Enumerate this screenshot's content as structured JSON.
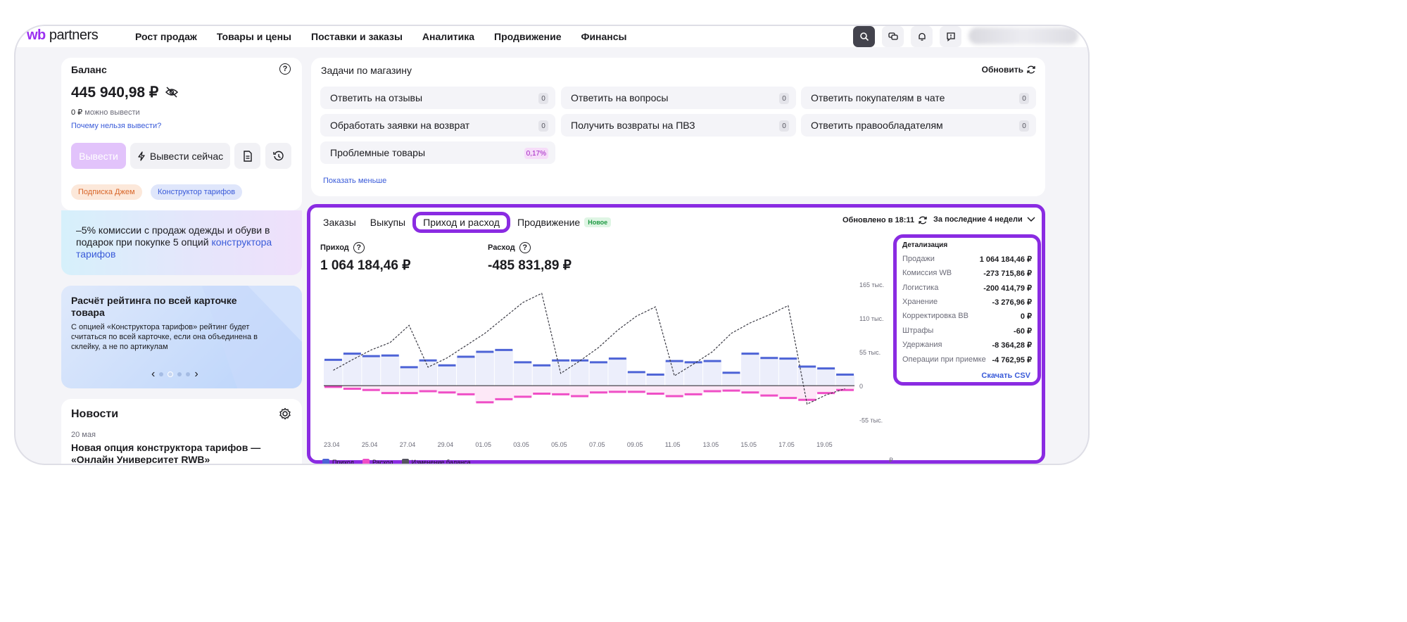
{
  "brand": {
    "wb": "wb",
    "partners": "partners"
  },
  "nav": [
    "Рост продаж",
    "Товары и цены",
    "Поставки и заказы",
    "Аналитика",
    "Продвижение",
    "Финансы"
  ],
  "top_icons": [
    "search-icon",
    "chat-icon",
    "bell-icon",
    "support-icon"
  ],
  "balance": {
    "title": "Баланс",
    "help": "?",
    "amount": "445 940,98 ₽",
    "available_value": "0 ₽",
    "available_label": "можно вывести",
    "why_link": "Почему нельзя вывести?",
    "withdraw_button": "Вывести",
    "withdraw_now_button": "Вывести сейчас",
    "chips": [
      "Подписка Джем",
      "Конструктор тарифов"
    ]
  },
  "promo": {
    "text": "–5% комиссии с продаж одежды и обуви в подарок при покупке 5 опций ",
    "link": "конструктора тарифов"
  },
  "rating": {
    "title": "Расчёт рейтинга по всей карточке товара",
    "body": "С опцией «Конструктора тарифов» рейтинг будет считаться по всей карточке, если она объединена в склейку, а не по артикулам",
    "prev": "‹",
    "next": "›"
  },
  "news": {
    "title": "Новости",
    "date": "20 мая",
    "headline": "Новая опция конструктора тарифов — «Онлайн Университет RWB»"
  },
  "tasks": {
    "title": "Задачи по магазину",
    "refresh": "Обновить",
    "items": [
      {
        "label": "Ответить на отзывы",
        "count": "0"
      },
      {
        "label": "Ответить на вопросы",
        "count": "0"
      },
      {
        "label": "Ответить покупателям в чате",
        "count": "0"
      },
      {
        "label": "Обработать заявки на возврат",
        "count": "0"
      },
      {
        "label": "Получить возвраты на ПВЗ",
        "count": "0"
      },
      {
        "label": "Ответить правообладателям",
        "count": "0"
      },
      {
        "label": "Проблемные товары",
        "count": "0,17%"
      }
    ],
    "show_less": "Показать меньше"
  },
  "finance": {
    "tabs": [
      "Заказы",
      "Выкупы",
      "Приход и расход",
      "Продвижение"
    ],
    "new_badge": "Новое",
    "updated": "Обновлено в 18:11",
    "period": "За последние 4 недели",
    "income_label": "Приход",
    "income_value": "1 064 184,46 ₽",
    "expense_label": "Расход",
    "expense_value": "-485 831,89 ₽",
    "currency_unit": "₽",
    "detail": {
      "title": "Детализация",
      "rows": [
        {
          "label": "Продажи",
          "value": "1 064 184,46 ₽"
        },
        {
          "label": "Комиссия WB",
          "value": "-273 715,86 ₽"
        },
        {
          "label": "Логистика",
          "value": "-200 414,79 ₽"
        },
        {
          "label": "Хранение",
          "value": "-3 276,96 ₽"
        },
        {
          "label": "Корректировка ВВ",
          "value": "0 ₽"
        },
        {
          "label": "Штрафы",
          "value": "-60 ₽"
        },
        {
          "label": "Удержания",
          "value": "-8 364,28 ₽"
        },
        {
          "label": "Операции при приемке",
          "value": "-4 762,95 ₽"
        }
      ],
      "csv": "Скачать CSV"
    },
    "legend": [
      "Приход",
      "Расход",
      "Изменение баланса"
    ]
  },
  "colors": {
    "accent": "#8a2be2",
    "income": "#4d63d6",
    "expense": "#ef4fc6",
    "link": "#3a5bd9"
  },
  "chart_data": {
    "type": "bar",
    "x_tick_labels": [
      "23.04",
      "25.04",
      "27.04",
      "29.04",
      "01.05",
      "03.05",
      "05.05",
      "07.05",
      "09.05",
      "11.05",
      "13.05",
      "15.05",
      "17.05",
      "19.05"
    ],
    "y_tick_labels": [
      "165 тыс.",
      "110 тыс.",
      "55 тыс.",
      "0",
      "-55 тыс."
    ],
    "ylim": [
      -65000,
      175000
    ],
    "y_ticks": [
      165000,
      110000,
      55000,
      0,
      -55000
    ],
    "series": [
      {
        "name": "Приход",
        "type": "bar",
        "values": [
          42000,
          52000,
          48000,
          49000,
          30000,
          41000,
          33000,
          47000,
          55000,
          58000,
          38000,
          33000,
          41000,
          41000,
          38000,
          44000,
          22000,
          18000,
          40000,
          38000,
          40000,
          21000,
          52000,
          45000,
          44000,
          31000,
          28000,
          18000
        ]
      },
      {
        "name": "Расход",
        "type": "bar",
        "values": [
          -2000,
          -5000,
          -7000,
          -12000,
          -12000,
          -9000,
          -11000,
          -14000,
          -27000,
          -22000,
          -18000,
          -13000,
          -14000,
          -17000,
          -11000,
          -10000,
          -10000,
          -13000,
          -17000,
          -14000,
          -9000,
          -8000,
          -11000,
          -16000,
          -20000,
          -23000,
          -12000,
          -7000
        ]
      },
      {
        "name": "Изменение баланса",
        "type": "line",
        "values": [
          25000,
          42000,
          58000,
          70000,
          98000,
          30000,
          45000,
          65000,
          85000,
          110000,
          135000,
          150000,
          20000,
          40000,
          62000,
          90000,
          113000,
          128000,
          16000,
          35000,
          55000,
          85000,
          102000,
          115000,
          130000,
          -30000,
          -15000,
          -5000
        ]
      }
    ]
  }
}
